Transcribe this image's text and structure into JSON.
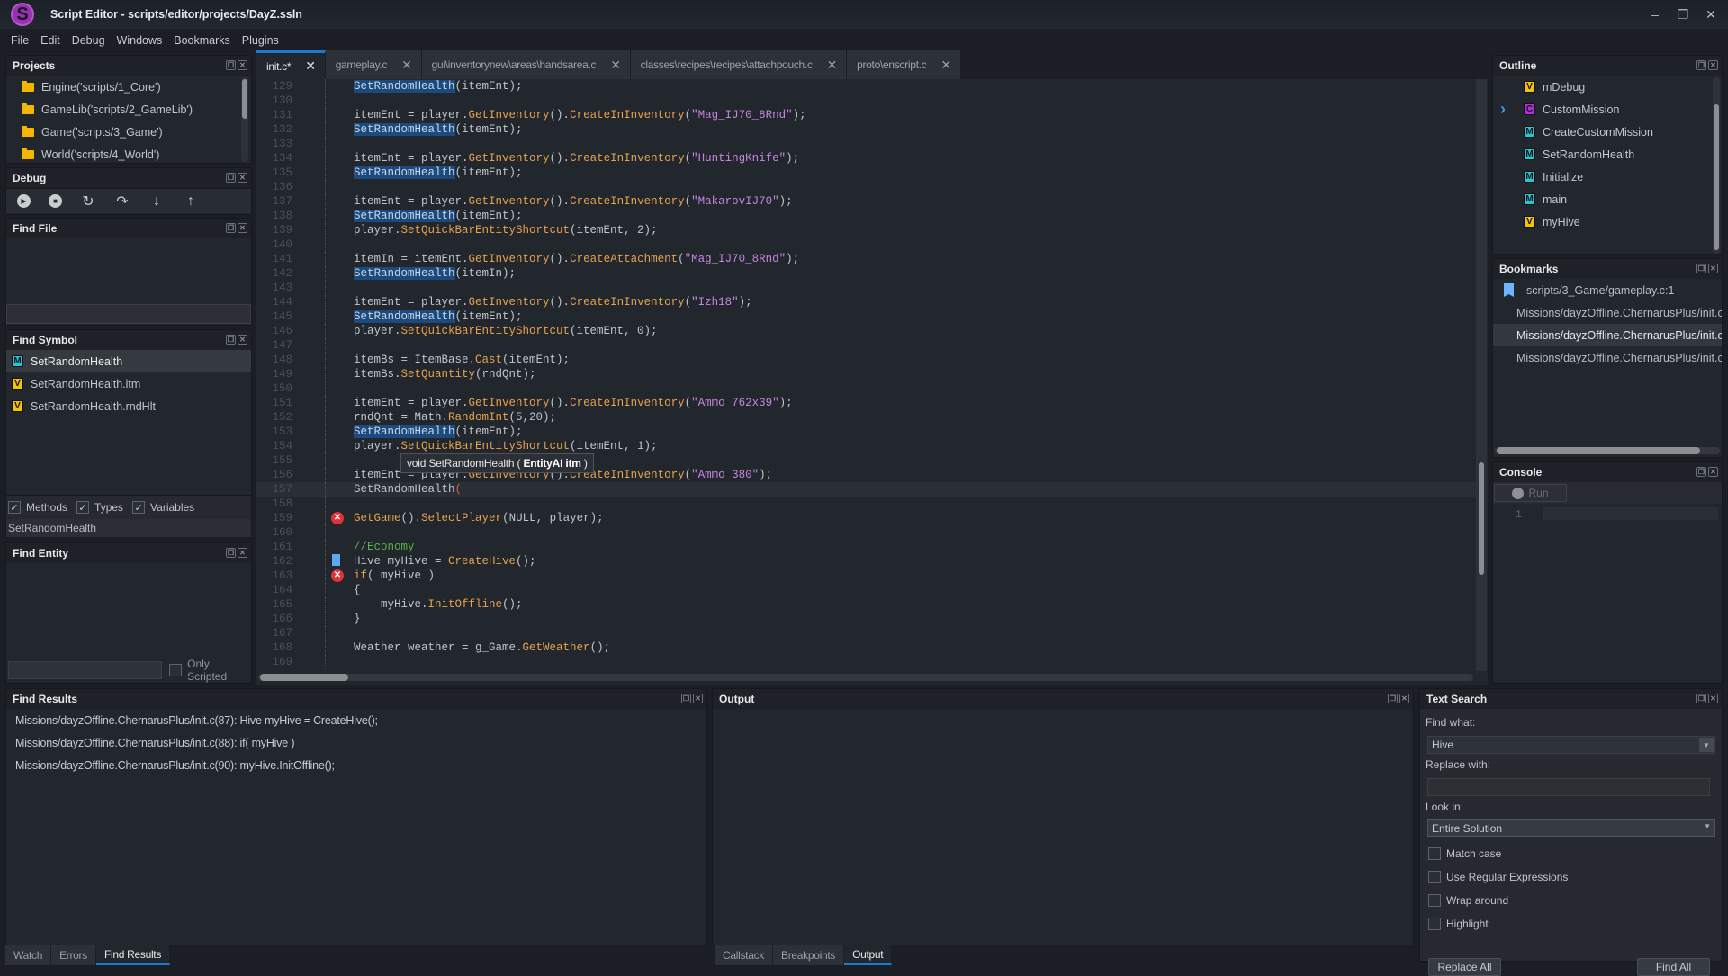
{
  "window": {
    "title": "Script Editor - scripts/editor/projects/DayZ.ssln",
    "logo_letter": "S",
    "controls": {
      "minimize": "–",
      "restore": "❐",
      "close": "✕"
    }
  },
  "menu": [
    "File",
    "Edit",
    "Debug",
    "Windows",
    "Bookmarks",
    "Plugins"
  ],
  "projects": {
    "title": "Projects",
    "items": [
      "Engine('scripts/1_Core')",
      "GameLib('scripts/2_GameLib')",
      "Game('scripts/3_Game')",
      "World('scripts/4_World')"
    ]
  },
  "debug": {
    "title": "Debug",
    "buttons": [
      {
        "name": "run-icon",
        "glyph": "▶"
      },
      {
        "name": "stop-icon",
        "glyph": "■"
      },
      {
        "name": "restart-icon",
        "glyph": "↻"
      },
      {
        "name": "step-over-icon",
        "glyph": "↷"
      },
      {
        "name": "step-into-icon",
        "glyph": "↓"
      },
      {
        "name": "step-out-icon",
        "glyph": "↑"
      }
    ]
  },
  "find_file": {
    "title": "Find File",
    "query": ""
  },
  "find_symbol": {
    "title": "Find Symbol",
    "results": [
      {
        "badge": "M",
        "label": "SetRandomHealth"
      },
      {
        "badge": "V",
        "label": "SetRandomHealth.itm"
      },
      {
        "badge": "V",
        "label": "SetRandomHealth.rndHlt"
      }
    ],
    "filters": [
      {
        "label": "Methods",
        "checked": true
      },
      {
        "label": "Types",
        "checked": true
      },
      {
        "label": "Variables",
        "checked": true
      }
    ],
    "query": "SetRandomHealth"
  },
  "find_entity": {
    "title": "Find Entity",
    "query": "",
    "only_scripted_label": "Only Scripted",
    "only_scripted": false
  },
  "editor": {
    "tabs": [
      {
        "label": "init.c*",
        "active": true
      },
      {
        "label": "gameplay.c",
        "active": false
      },
      {
        "label": "gui\\inventorynew\\areas\\handsarea.c",
        "active": false
      },
      {
        "label": "classes\\recipes\\recipes\\attachpouch.c",
        "active": false
      },
      {
        "label": "proto\\enscript.c",
        "active": false
      }
    ],
    "current_line": 157,
    "tooltip": {
      "prefix": "void SetRandomHealth ( ",
      "param": "EntityAI itm",
      "suffix": " )"
    },
    "lines": [
      {
        "n": 129,
        "code": "    SetRandomHealth(itemEnt);"
      },
      {
        "n": 130,
        "code": ""
      },
      {
        "n": 131,
        "code": "    itemEnt = player.GetInventory().CreateInInventory(\"Mag_IJ70_8Rnd\");"
      },
      {
        "n": 132,
        "code": "    SetRandomHealth(itemEnt);"
      },
      {
        "n": 133,
        "code": ""
      },
      {
        "n": 134,
        "code": "    itemEnt = player.GetInventory().CreateInInventory(\"HuntingKnife\");"
      },
      {
        "n": 135,
        "code": "    SetRandomHealth(itemEnt);"
      },
      {
        "n": 136,
        "code": ""
      },
      {
        "n": 137,
        "code": "    itemEnt = player.GetInventory().CreateInInventory(\"MakarovIJ70\");"
      },
      {
        "n": 138,
        "code": "    SetRandomHealth(itemEnt);"
      },
      {
        "n": 139,
        "code": "    player.SetQuickBarEntityShortcut(itemEnt, 2);"
      },
      {
        "n": 140,
        "code": ""
      },
      {
        "n": 141,
        "code": "    itemIn = itemEnt.GetInventory().CreateAttachment(\"Mag_IJ70_8Rnd\");"
      },
      {
        "n": 142,
        "code": "    SetRandomHealth(itemIn);"
      },
      {
        "n": 143,
        "code": ""
      },
      {
        "n": 144,
        "code": "    itemEnt = player.GetInventory().CreateInInventory(\"Izh18\");"
      },
      {
        "n": 145,
        "code": "    SetRandomHealth(itemEnt);"
      },
      {
        "n": 146,
        "code": "    player.SetQuickBarEntityShortcut(itemEnt, 0);"
      },
      {
        "n": 147,
        "code": ""
      },
      {
        "n": 148,
        "code": "    itemBs = ItemBase.Cast(itemEnt);"
      },
      {
        "n": 149,
        "code": "    itemBs.SetQuantity(rndQnt);"
      },
      {
        "n": 150,
        "code": ""
      },
      {
        "n": 151,
        "code": "    itemEnt = player.GetInventory().CreateInInventory(\"Ammo_762x39\");"
      },
      {
        "n": 152,
        "code": "    rndQnt = Math.RandomInt(5,20);"
      },
      {
        "n": 153,
        "code": "    SetRandomHealth(itemEnt);"
      },
      {
        "n": 154,
        "code": "    player.SetQuickBarEntityShortcut(itemEnt, 1);"
      },
      {
        "n": 155,
        "code": ""
      },
      {
        "n": 156,
        "code": "    itemEnt = player.GetInventory().CreateInInventory(\"Ammo_380\");"
      },
      {
        "n": 157,
        "code": "    SetRandomHealth("
      },
      {
        "n": 158,
        "code": ""
      },
      {
        "n": 159,
        "code": "    GetGame().SelectPlayer(NULL, player);",
        "marker": "error"
      },
      {
        "n": 160,
        "code": ""
      },
      {
        "n": 161,
        "code": "    //Economy"
      },
      {
        "n": 162,
        "code": "    Hive myHive = CreateHive();",
        "marker": "bookmark"
      },
      {
        "n": 163,
        "code": "    if( myHive )",
        "marker": "error"
      },
      {
        "n": 164,
        "code": "    {"
      },
      {
        "n": 165,
        "code": "        myHive.InitOffline();"
      },
      {
        "n": 166,
        "code": "    }"
      },
      {
        "n": 167,
        "code": ""
      },
      {
        "n": 168,
        "code": "    Weather weather = g_Game.GetWeather();"
      },
      {
        "n": 169,
        "code": ""
      }
    ]
  },
  "outline": {
    "title": "Outline",
    "items": [
      {
        "badge": "V",
        "label": "mDebug",
        "expandable": false
      },
      {
        "badge": "C",
        "label": "CustomMission",
        "expandable": true
      },
      {
        "badge": "M",
        "label": "CreateCustomMission",
        "expandable": false
      },
      {
        "badge": "M",
        "label": "SetRandomHealth",
        "expandable": false
      },
      {
        "badge": "M",
        "label": "Initialize",
        "expandable": false
      },
      {
        "badge": "M",
        "label": "main",
        "expandable": false
      },
      {
        "badge": "V",
        "label": "myHive",
        "expandable": false
      }
    ]
  },
  "bookmarks": {
    "title": "Bookmarks",
    "items": [
      {
        "label": "scripts/3_Game/gameplay.c:1",
        "selected": false
      },
      {
        "label": "Missions/dayzOffline.ChernarusPlus/init.c",
        "selected": false
      },
      {
        "label": "Missions/dayzOffline.ChernarusPlus/init.c",
        "selected": true
      },
      {
        "label": "Missions/dayzOffline.ChernarusPlus/init.c",
        "selected": false
      }
    ]
  },
  "console": {
    "title": "Console",
    "run_label": "Run",
    "line_number": "1"
  },
  "find_results": {
    "title": "Find Results",
    "items": [
      "Missions/dayzOffline.ChernarusPlus/init.c(87): Hive myHive = CreateHive();",
      "Missions/dayzOffline.ChernarusPlus/init.c(88): if( myHive )",
      "Missions/dayzOffline.ChernarusPlus/init.c(90): myHive.InitOffline();"
    ]
  },
  "output": {
    "title": "Output"
  },
  "bottom_tabs_left": [
    {
      "label": "Watch",
      "active": false
    },
    {
      "label": "Errors",
      "active": false
    },
    {
      "label": "Find Results",
      "active": true
    }
  ],
  "bottom_tabs_right": [
    {
      "label": "Callstack",
      "active": false
    },
    {
      "label": "Breakpoints",
      "active": false
    },
    {
      "label": "Output",
      "active": true
    }
  ],
  "text_search": {
    "title": "Text Search",
    "find_what_label": "Find what:",
    "find_what_value": "Hive",
    "replace_with_label": "Replace with:",
    "replace_with_value": "",
    "look_in_label": "Look in:",
    "look_in_value": "Entire Solution",
    "options": [
      {
        "label": "Match case",
        "checked": false
      },
      {
        "label": "Use Regular Expressions",
        "checked": false
      },
      {
        "label": "Wrap around",
        "checked": false
      },
      {
        "label": "Highlight",
        "checked": false
      }
    ],
    "replace_all_label": "Replace All",
    "find_all_label": "Find All"
  },
  "colors": {
    "accent": "#1b7ad1",
    "highlight": "#1c4a7c",
    "function": "#e6a24d",
    "string": "#c586e0",
    "comment": "#5ab34a",
    "error": "#e0313b",
    "bookmark": "#6cb6fb"
  }
}
